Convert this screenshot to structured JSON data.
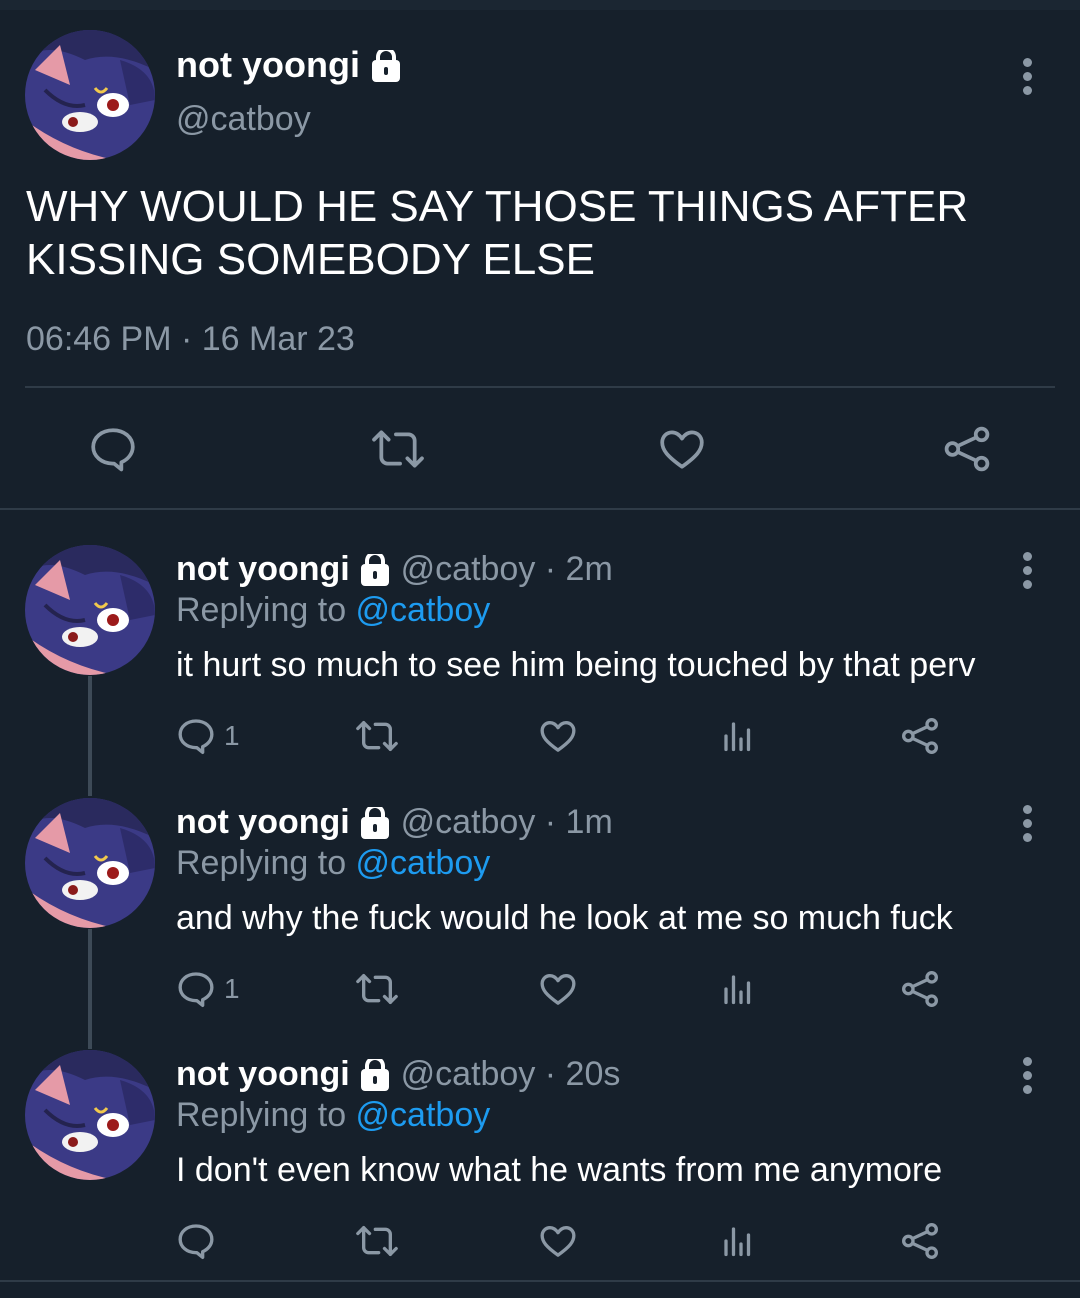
{
  "main_tweet": {
    "display_name": "not yoongi",
    "handle": "@catboy",
    "text": "WHY WOULD HE SAY THOSE THINGS AFTER KISSING SOMEBODY ELSE",
    "timestamp": "06:46 PM · 16 Mar 23",
    "actions": [
      "reply-icon",
      "retweet-icon",
      "like-icon",
      "share-icon"
    ]
  },
  "replies": [
    {
      "display_name": "not yoongi",
      "handle_time": "@catboy · 2m",
      "replying_prefix": "Replying to ",
      "replying_to": "@catboy",
      "text": "it hurt so much to see him being touched by that perv",
      "reply_count": "1"
    },
    {
      "display_name": "not yoongi",
      "handle_time": "@catboy · 1m",
      "replying_prefix": "Replying to ",
      "replying_to": "@catboy",
      "text": "and why the fuck would he look at me so much fuck",
      "reply_count": "1"
    },
    {
      "display_name": "not yoongi",
      "handle_time": "@catboy · 20s",
      "replying_prefix": "Replying to ",
      "replying_to": "@catboy",
      "text": "I don't even know what he wants from me anymore",
      "reply_count": ""
    }
  ],
  "colors": {
    "background": "#16202b",
    "muted": "#8b98a5",
    "link": "#1d9bf0"
  }
}
